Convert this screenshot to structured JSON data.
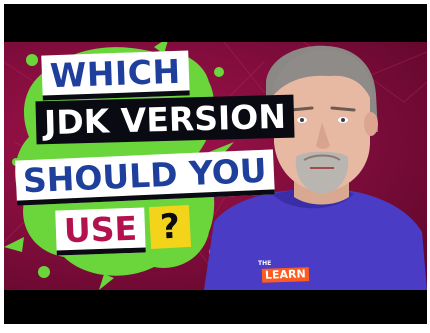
{
  "headline": {
    "line1": "WHICH",
    "line2": "JDK VERSION",
    "line3": "SHOULD YOU",
    "line4": "USE",
    "question_mark": "?"
  },
  "shirt_logo": {
    "top": "THE",
    "main": "LEARN"
  },
  "colors": {
    "background": "#8a0e40",
    "splash": "#6bd53c",
    "headline_blue": "#1f3f9c",
    "headline_magenta": "#b3124f",
    "question_box": "#f3d41b",
    "shirt": "#4a3cc4",
    "logo_orange": "#ff5a1f"
  }
}
